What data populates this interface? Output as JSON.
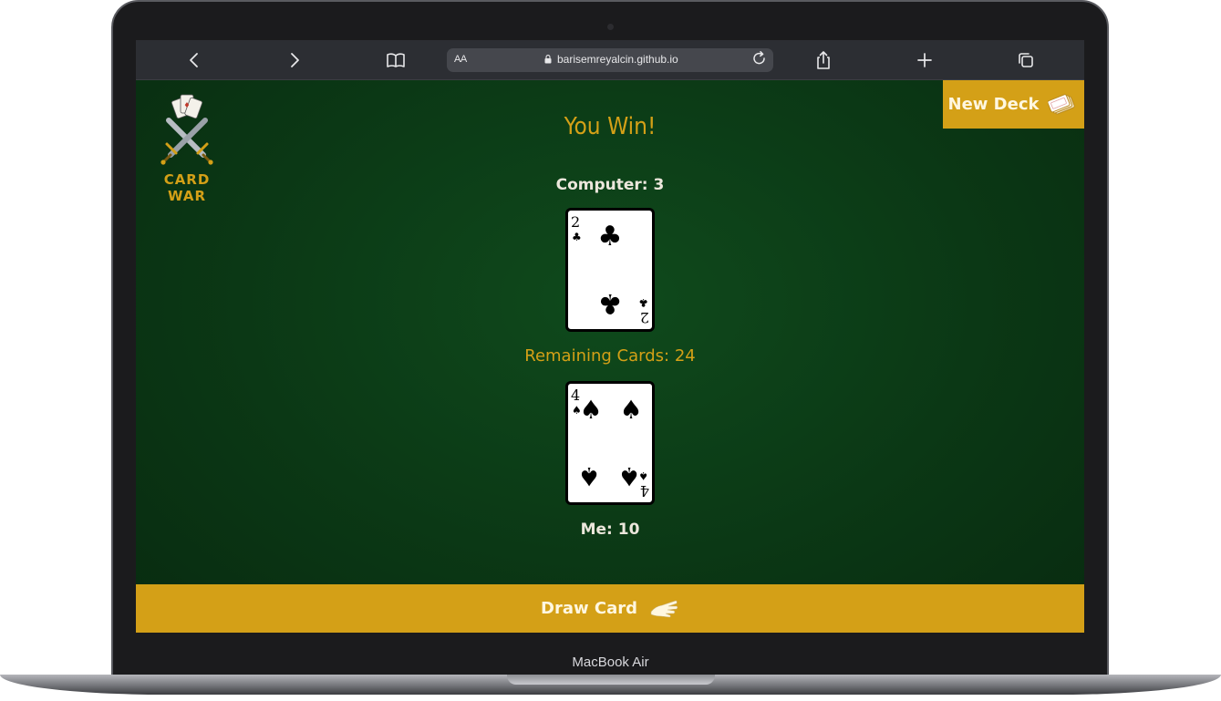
{
  "device": {
    "label": "MacBook Air"
  },
  "browser": {
    "address_bar": {
      "text_size_label": "AA",
      "url": "barisemreyalcin.github.io"
    },
    "icons": [
      "back-icon",
      "forward-icon",
      "bookmarks-icon",
      "reload-icon",
      "share-icon",
      "new-tab-icon",
      "tabs-icon"
    ]
  },
  "app": {
    "logo_label": "CARD WAR",
    "new_deck_label": "New Deck",
    "result_message": "You Win!",
    "computer_score": "Computer: 3",
    "remaining_cards": "Remaining Cards: 24",
    "player_score": "Me: 10",
    "draw_button_label": "Draw Card",
    "computer_card": {
      "rank": "2",
      "suit": "clubs",
      "symbol": "♣"
    },
    "player_card": {
      "rank": "4",
      "suit": "spades",
      "symbol": "♠"
    }
  },
  "colors": {
    "accent": "#d4a017",
    "table": "#0c3a16",
    "toolbar": "#2c2e33"
  }
}
